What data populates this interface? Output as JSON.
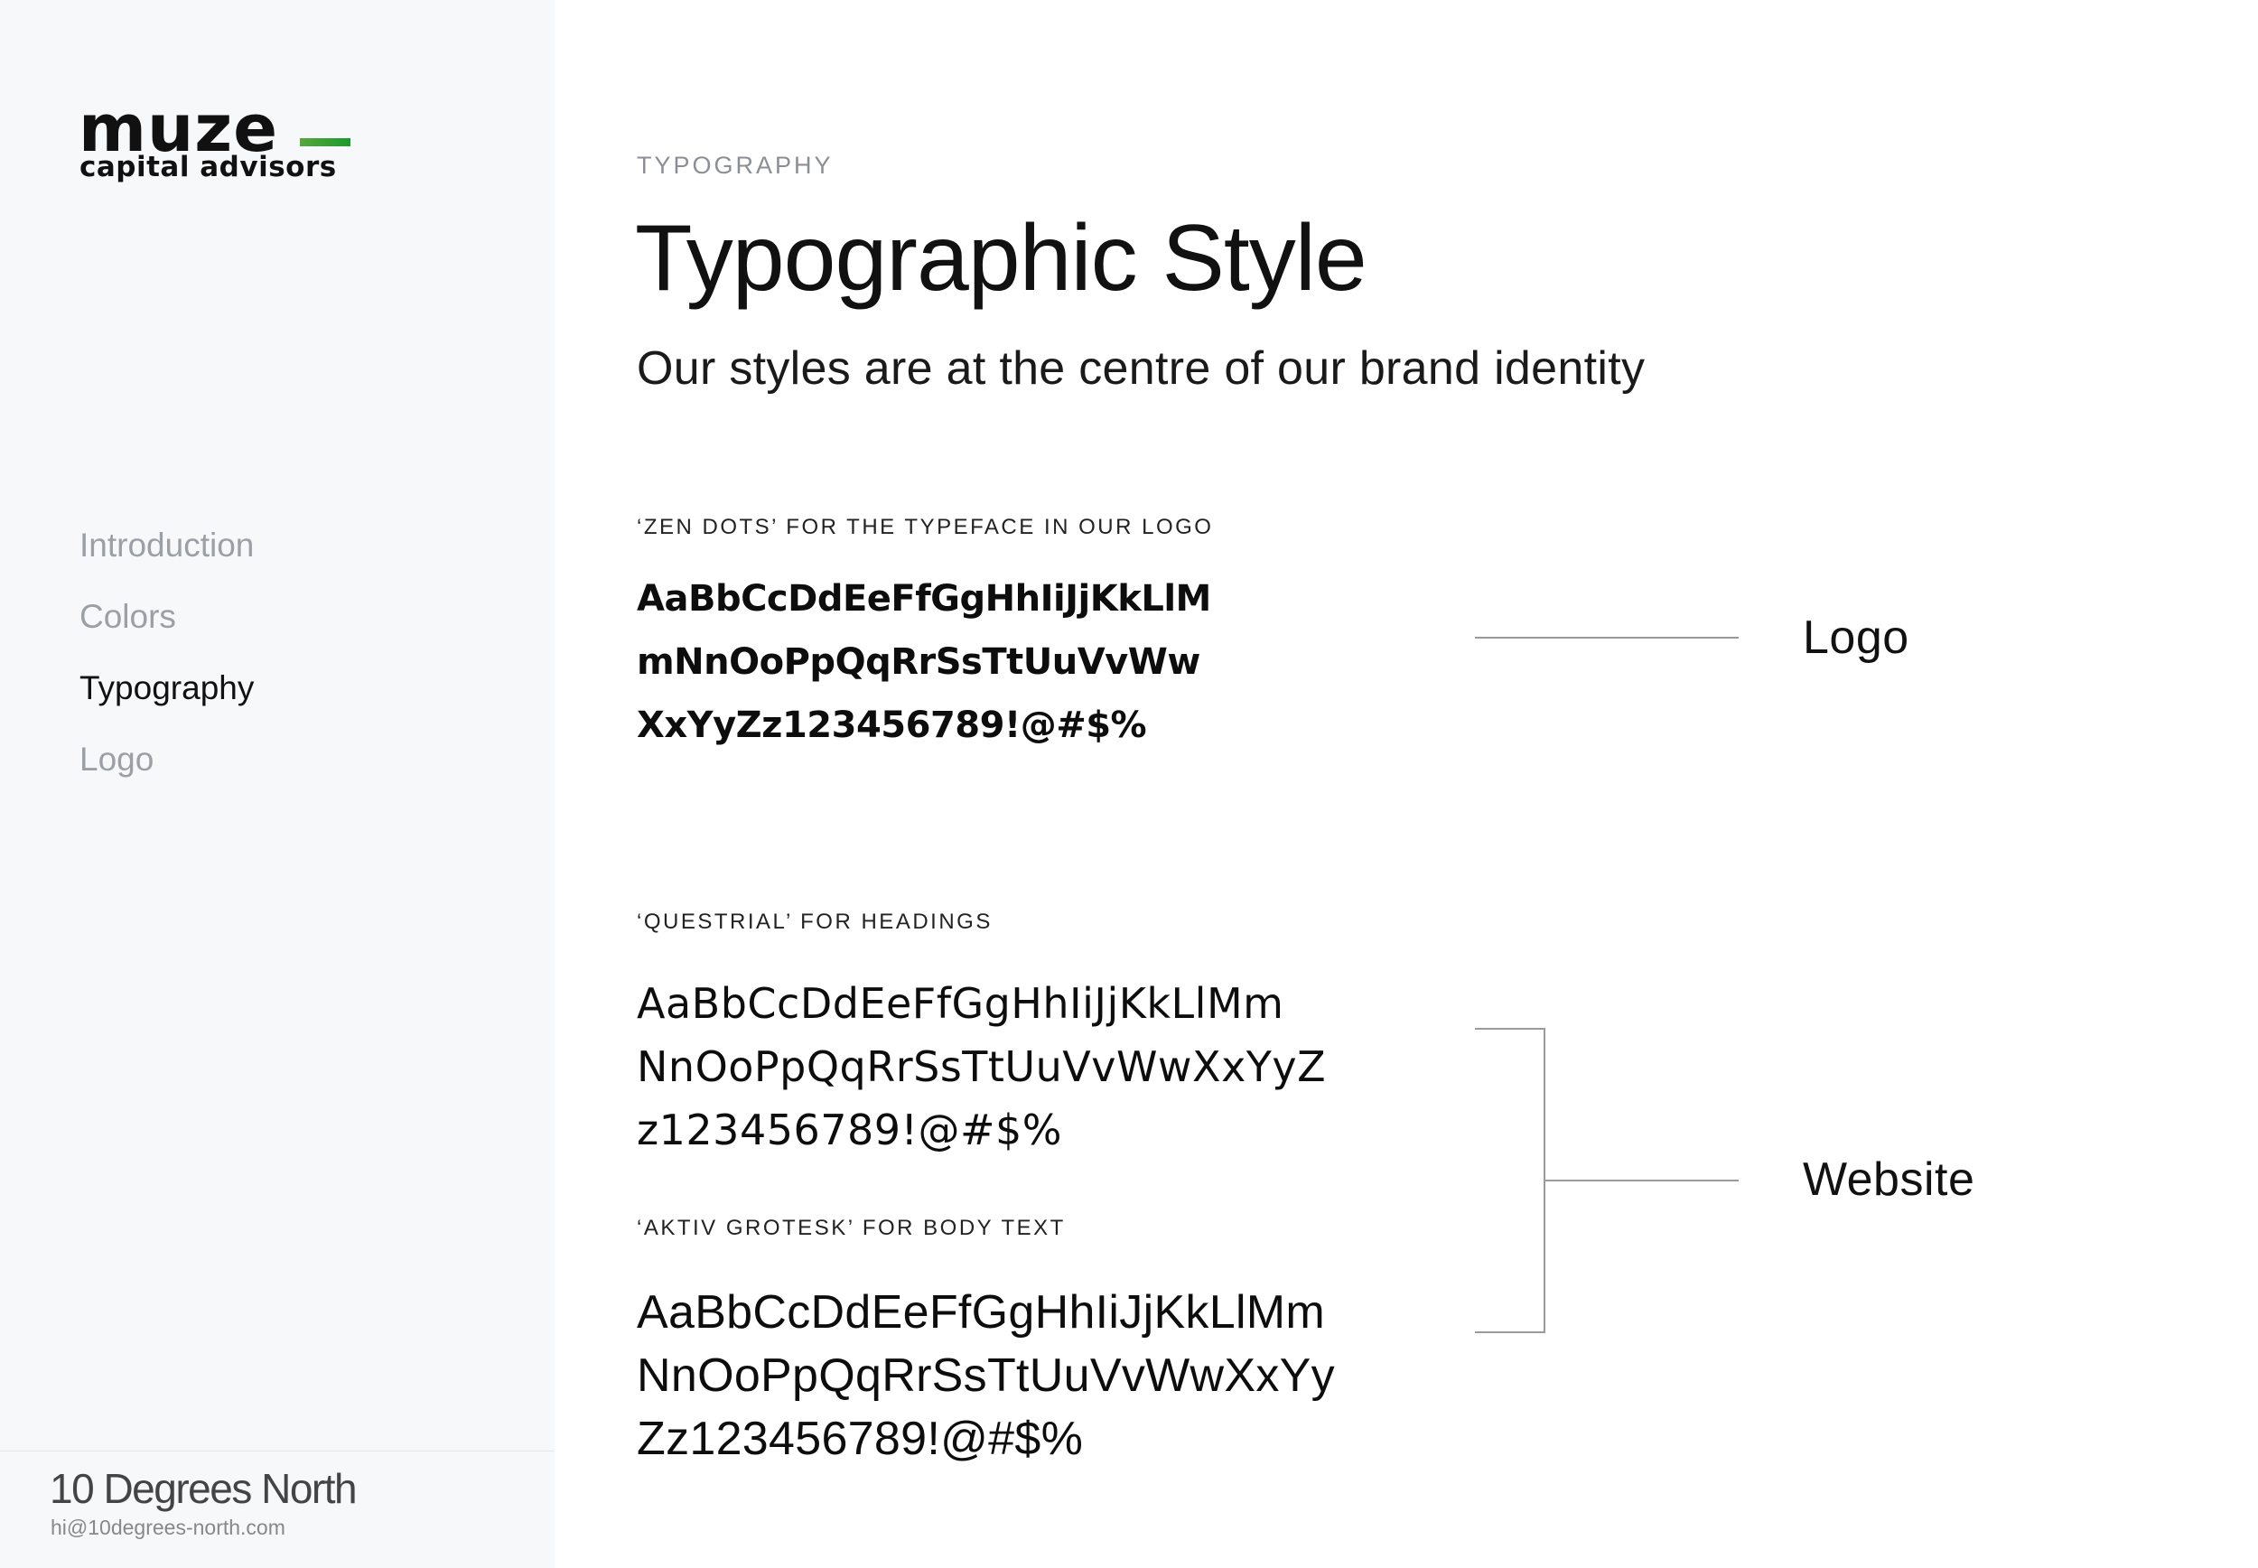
{
  "sidebar": {
    "logo": {
      "wordmark": "muze",
      "tagline": "capital advisors"
    },
    "nav": [
      {
        "label": "Introduction"
      },
      {
        "label": "Colors"
      },
      {
        "label": "Typography"
      },
      {
        "label": "Logo"
      }
    ],
    "active_nav": "Typography",
    "footer": {
      "brand": "10 Degrees North",
      "email": "hi@10degrees-north.com"
    }
  },
  "main": {
    "eyebrow": "TYPOGRAPHY",
    "title": "Typographic Style",
    "subtitle": "Our styles are at the centre of our brand identity",
    "sections": [
      {
        "label": "‘ZEN DOTS’ FOR THE TYPEFACE IN OUR LOGO",
        "lines": [
          "AaBbCcDdEeFfGgHhIiJjKkLlM",
          "mNnOoPpQqRrSsTtUuVvWw",
          "XxYyZz123456789!@#$%"
        ]
      },
      {
        "label": "‘QUESTRIAL’ FOR HEADINGS",
        "lines": [
          "AaBbCcDdEeFfGgHhIiJjKkLlMm",
          "NnOoPpQqRrSsTtUuVvWwXxYyZ",
          "z123456789!@#$%"
        ]
      },
      {
        "label": "‘AKTIV GROTESK’ FOR BODY TEXT",
        "lines": [
          "AaBbCcDdEeFfGgHhIiJjKkLlMm",
          "NnOoPpQqRrSsTtUuVvWwXxYy",
          "Zz123456789!@#$%"
        ]
      }
    ],
    "callouts": {
      "logo": "Logo",
      "website": "Website"
    }
  },
  "colors": {
    "accent_green": "#1a9a2e",
    "sidebar_bg": "#f7f8fa",
    "muted_text": "#9aa0a6"
  }
}
